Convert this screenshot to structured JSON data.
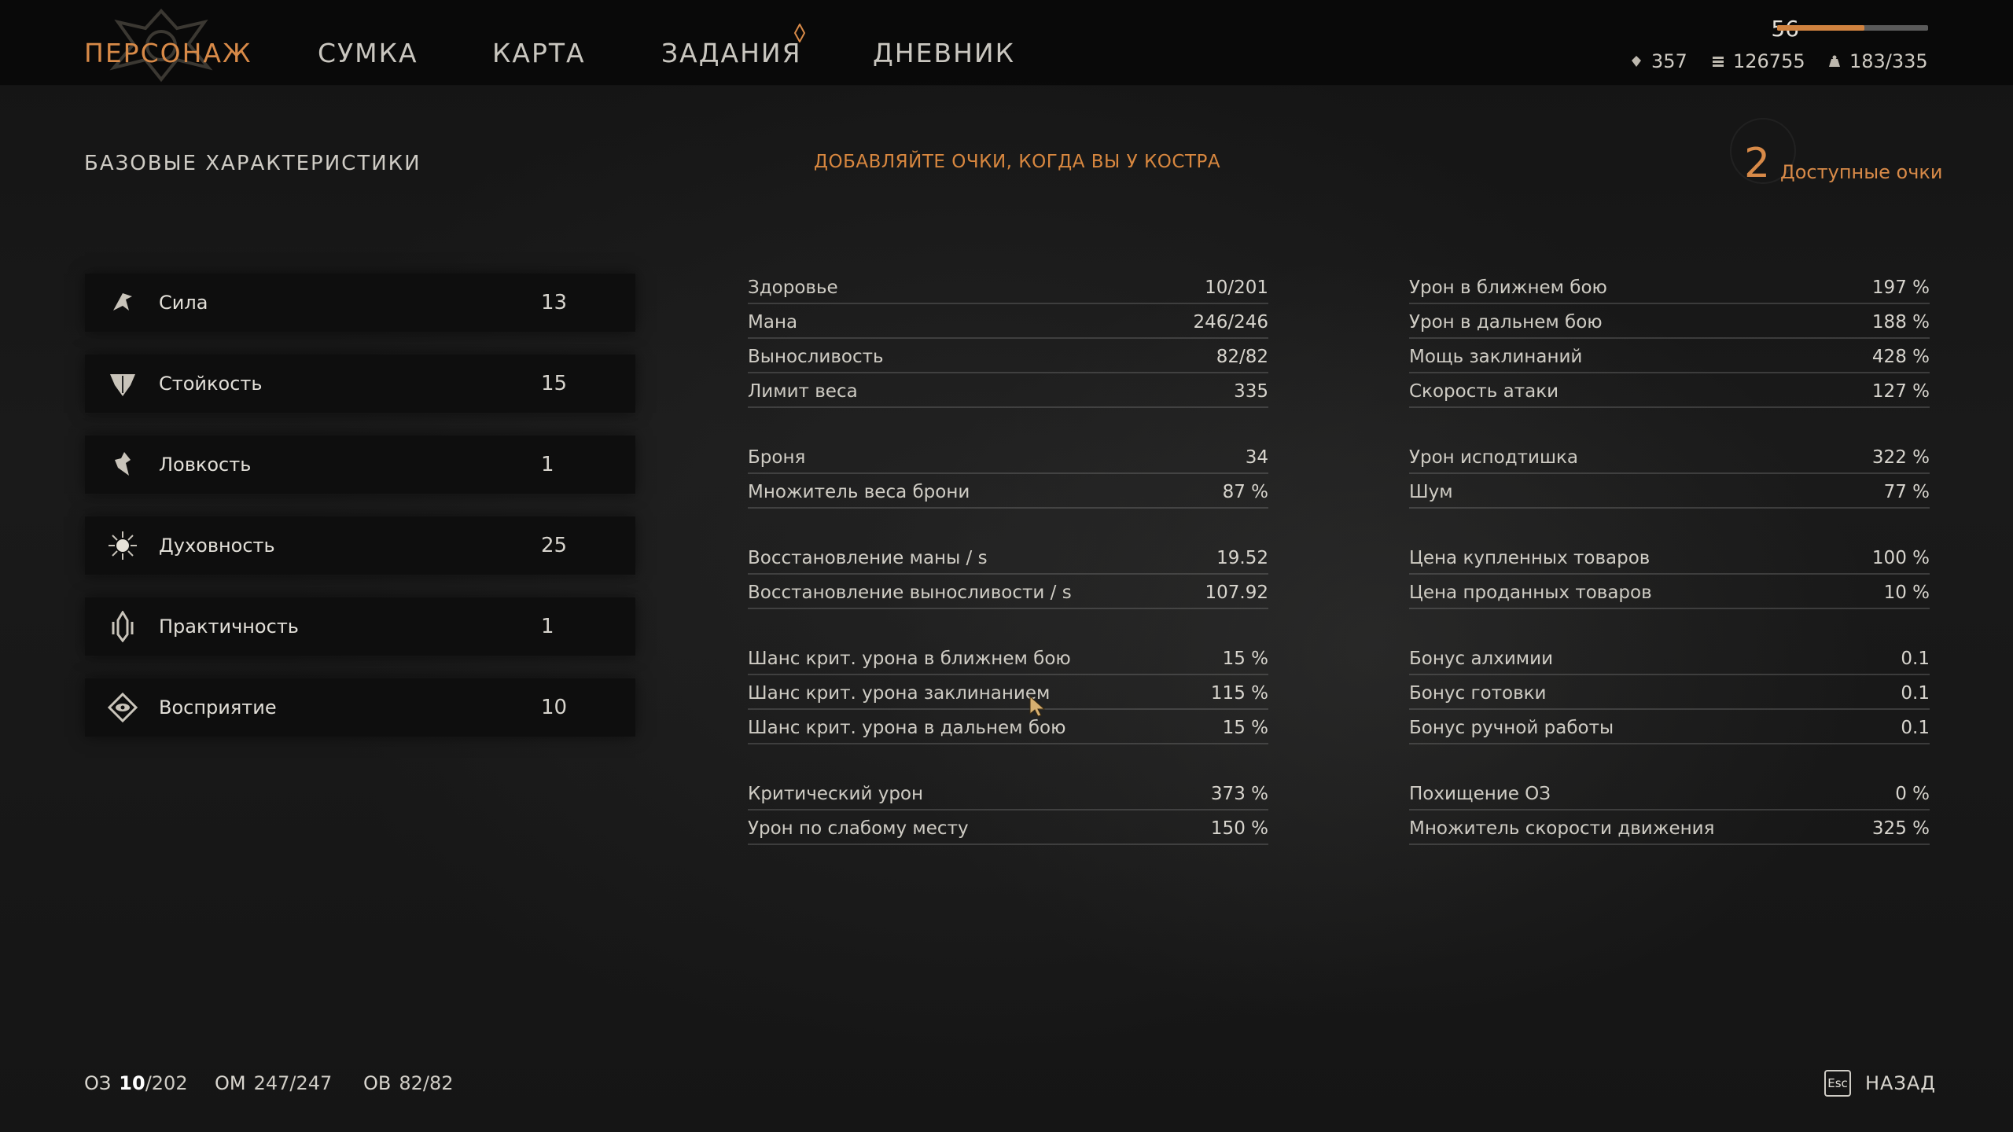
{
  "nav": {
    "tabs": [
      {
        "label": "ПЕРСОНАЖ",
        "active": true
      },
      {
        "label": "СУМКА"
      },
      {
        "label": "КАРТА"
      },
      {
        "label": "ЗАДАНИЯ",
        "has_notification": true
      },
      {
        "label": "ДНЕВНИК"
      }
    ]
  },
  "player": {
    "level": "56",
    "xp_fraction": 0.58,
    "resources": [
      {
        "icon": "crystal-icon",
        "value": "357"
      },
      {
        "icon": "coins-icon",
        "value": "126755"
      },
      {
        "icon": "weight-icon",
        "value": "183/335"
      }
    ]
  },
  "header": {
    "section_title": "БАЗОВЫЕ ХАРАКТЕРИСТИКИ",
    "hint": "ДОБАВЛЯЙТЕ ОЧКИ, КОГДА ВЫ У КОСТРА",
    "points_value": "2",
    "points_label": "Доступные очки"
  },
  "attributes": [
    {
      "name": "Сила",
      "value": "13",
      "icon": "strength-icon"
    },
    {
      "name": "Стойкость",
      "value": "15",
      "icon": "endurance-icon"
    },
    {
      "name": "Ловкость",
      "value": "1",
      "icon": "agility-icon"
    },
    {
      "name": "Духовность",
      "value": "25",
      "icon": "spirituality-icon"
    },
    {
      "name": "Практичность",
      "value": "1",
      "icon": "practicality-icon"
    },
    {
      "name": "Восприятие",
      "value": "10",
      "icon": "perception-icon"
    }
  ],
  "stats_left": [
    {
      "label": "Здоровье",
      "value": "10/201"
    },
    {
      "label": "Мана",
      "value": "246/246"
    },
    {
      "label": "Выносливость",
      "value": "82/82"
    },
    {
      "label": "Лимит веса",
      "value": "335"
    },
    {
      "label": "Броня",
      "value": "34"
    },
    {
      "label": "Множитель веса брони",
      "value": "87 %"
    },
    {
      "label": "Восстановление маны / s",
      "value": "19.52"
    },
    {
      "label": "Восстановление выносливости / s",
      "value": "107.92"
    },
    {
      "label": "Шанс крит. урона в ближнем бою",
      "value": "15 %"
    },
    {
      "label": "Шанс крит. урона заклинанием",
      "value": "115 %"
    },
    {
      "label": "Шанс крит. урона в дальнем бою",
      "value": "15 %"
    },
    {
      "label": "Критический урон",
      "value": "373 %"
    },
    {
      "label": "Урон по слабому месту",
      "value": "150 %"
    }
  ],
  "stats_right": [
    {
      "label": "Урон в ближнем бою",
      "value": "197 %"
    },
    {
      "label": "Урон в дальнем бою",
      "value": "188 %"
    },
    {
      "label": "Мощь заклинаний",
      "value": "428 %"
    },
    {
      "label": "Скорость атаки",
      "value": "127 %"
    },
    {
      "label": "Урон исподтишка",
      "value": "322 %"
    },
    {
      "label": "Шум",
      "value": "77 %"
    },
    {
      "label": "Цена купленных товаров",
      "value": "100 %"
    },
    {
      "label": "Цена проданных товаров",
      "value": "10 %"
    },
    {
      "label": "Бонус алхимии",
      "value": "0.1"
    },
    {
      "label": "Бонус готовки",
      "value": "0.1"
    },
    {
      "label": "Бонус ручной работы",
      "value": "0.1"
    },
    {
      "label": "Похищение ОЗ",
      "value": "0 %"
    },
    {
      "label": "Множитель скорости движения",
      "value": "325 %"
    }
  ],
  "footer": {
    "hp_label": "ОЗ",
    "hp_current": "10",
    "hp_max": "/202",
    "mp_label": "ОМ",
    "mp_value": "247/247",
    "sp_label": "ОВ",
    "sp_value": "82/82",
    "esc_key": "Esc",
    "back_label": "НАЗАД"
  },
  "colors": {
    "accent": "#d88a48",
    "text": "#d6d3cc",
    "background": "#161616"
  }
}
